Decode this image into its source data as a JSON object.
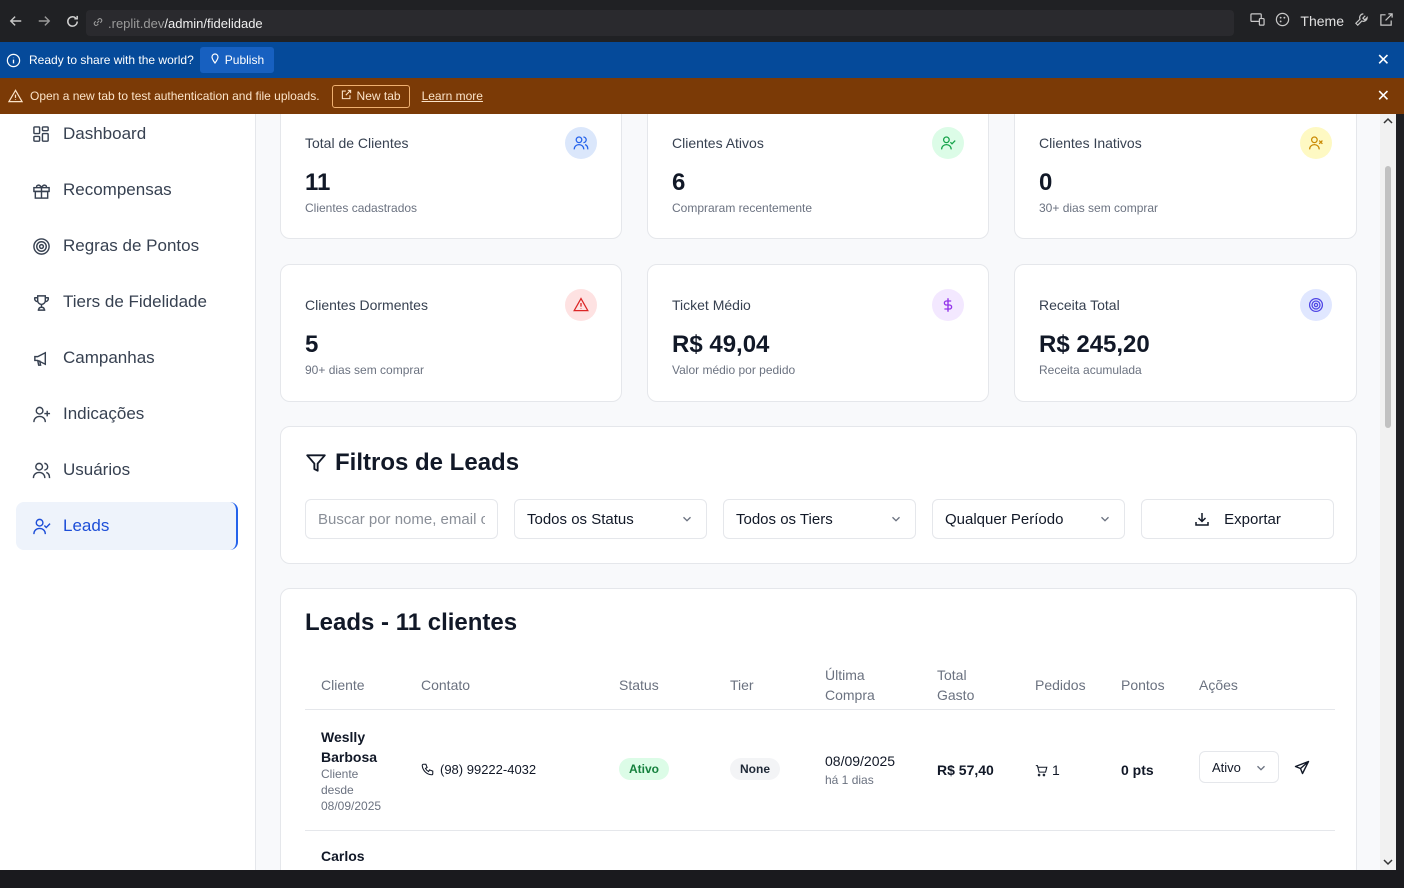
{
  "browser": {
    "url_host": ".replit.dev",
    "url_path": "/admin/fidelidade",
    "theme_label": "Theme"
  },
  "banner_blue": {
    "text": "Ready to share with the world?",
    "publish_label": "Publish"
  },
  "banner_orange": {
    "text": "Open a new tab to test authentication and file uploads.",
    "newtab_label": "New tab",
    "learn_label": "Learn more"
  },
  "sidebar": {
    "items": [
      {
        "label": "Dashboard"
      },
      {
        "label": "Recompensas"
      },
      {
        "label": "Regras de Pontos"
      },
      {
        "label": "Tiers de Fidelidade"
      },
      {
        "label": "Campanhas"
      },
      {
        "label": "Indicações"
      },
      {
        "label": "Usuários"
      },
      {
        "label": "Leads"
      }
    ]
  },
  "stats": [
    {
      "label": "Total de Clientes",
      "value": "11",
      "sub": "Clientes cadastrados",
      "icon": "users-icon",
      "color": "#2563eb",
      "bg": "#dbe7fb"
    },
    {
      "label": "Clientes Ativos",
      "value": "6",
      "sub": "Compraram recentemente",
      "icon": "user-check-icon",
      "color": "#16a34a",
      "bg": "#dcfce7"
    },
    {
      "label": "Clientes Inativos",
      "value": "0",
      "sub": "30+ dias sem comprar",
      "icon": "user-x-icon",
      "color": "#ca8a04",
      "bg": "#fef9c3"
    },
    {
      "label": "Clientes Dormentes",
      "value": "5",
      "sub": "90+ dias sem comprar",
      "icon": "alert-triangle-icon",
      "color": "#dc2626",
      "bg": "#fee2e2"
    },
    {
      "label": "Ticket Médio",
      "value": "R$ 49,04",
      "sub": "Valor médio por pedido",
      "icon": "dollar-icon",
      "color": "#9333ea",
      "bg": "#f3e8ff"
    },
    {
      "label": "Receita Total",
      "value": "R$ 245,20",
      "sub": "Receita acumulada",
      "icon": "target-icon",
      "color": "#4f46e5",
      "bg": "#e0e7ff"
    }
  ],
  "filters": {
    "title": "Filtros de Leads",
    "search_placeholder": "Buscar por nome, email ou telefone",
    "status": "Todos os Status",
    "tier": "Todos os Tiers",
    "period": "Qualquer Período",
    "export_label": "Exportar"
  },
  "leads": {
    "title": "Leads - 11 clientes",
    "headers": {
      "cliente": "Cliente",
      "contato": "Contato",
      "status": "Status",
      "tier": "Tier",
      "ultima_1": "Última",
      "ultima_2": "Compra",
      "total_1": "Total",
      "total_2": "Gasto",
      "pedidos": "Pedidos",
      "pontos": "Pontos",
      "acoes": "Ações"
    },
    "rows": [
      {
        "name_1": "Weslly",
        "name_2": "Barbosa",
        "since_1": "Cliente",
        "since_2": "desde",
        "since_3": "08/09/2025",
        "phone": "(98) 99222-4032",
        "status": "Ativo",
        "tier": "None",
        "last_date": "08/09/2025",
        "last_ago": "há 1 dias",
        "total": "R$ 57,40",
        "orders": "1",
        "points": "0 pts",
        "action_status": "Ativo"
      },
      {
        "name_1": "Carlos"
      }
    ]
  }
}
